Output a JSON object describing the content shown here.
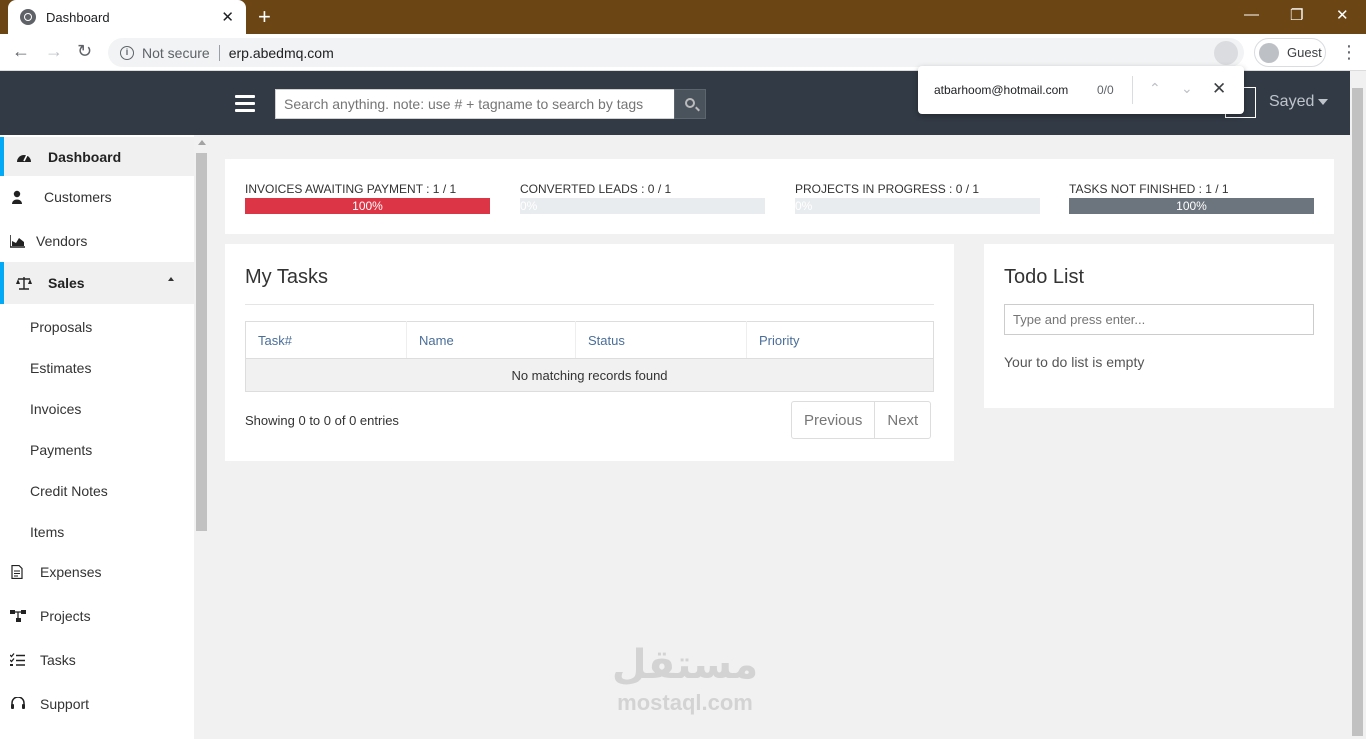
{
  "browser": {
    "tab_title": "Dashboard",
    "new_tab": "+",
    "close_tab": "✕",
    "not_secure": "Not secure",
    "url": "erp.abedmq.com",
    "profile": "Guest",
    "window": {
      "minimize": "—",
      "restore": "❐",
      "close": "✕"
    }
  },
  "find": {
    "query": "atbarhoom@hotmail.com",
    "count": "0/0"
  },
  "header": {
    "search_placeholder": "Search anything. note: use # + tagname to search by tags",
    "user": "Sayed"
  },
  "sidebar": {
    "items": [
      {
        "label": "Dashboard"
      },
      {
        "label": "Customers"
      },
      {
        "label": "Vendors"
      },
      {
        "label": "Sales"
      },
      {
        "label": "Expenses"
      },
      {
        "label": "Projects"
      },
      {
        "label": "Tasks"
      },
      {
        "label": "Support"
      }
    ],
    "sales_sub": [
      "Proposals",
      "Estimates",
      "Invoices",
      "Payments",
      "Credit Notes",
      "Items"
    ]
  },
  "stats": [
    {
      "label": "INVOICES AWAITING PAYMENT : 1 / 1",
      "percent": 100,
      "percent_text": "100%",
      "color": "#dc3545"
    },
    {
      "label": "CONVERTED LEADS : 0 / 1",
      "percent": 0,
      "percent_text": "0%",
      "color": "#e9ecef"
    },
    {
      "label": "PROJECTS IN PROGRESS : 0 / 1",
      "percent": 0,
      "percent_text": "0%",
      "color": "#e9ecef"
    },
    {
      "label": "TASKS NOT FINISHED : 1 / 1",
      "percent": 100,
      "percent_text": "100%",
      "color": "#6c757d"
    }
  ],
  "my_tasks": {
    "title": "My Tasks",
    "columns": [
      "Task#",
      "Name",
      "Status",
      "Priority"
    ],
    "empty": "No matching records found",
    "showing": "Showing 0 to 0 of 0 entries",
    "prev": "Previous",
    "next": "Next"
  },
  "todo": {
    "title": "Todo List",
    "placeholder": "Type and press enter...",
    "empty": "Your to do list is empty"
  },
  "watermark": {
    "arabic": "مستقل",
    "latin": "mostaql.com"
  }
}
